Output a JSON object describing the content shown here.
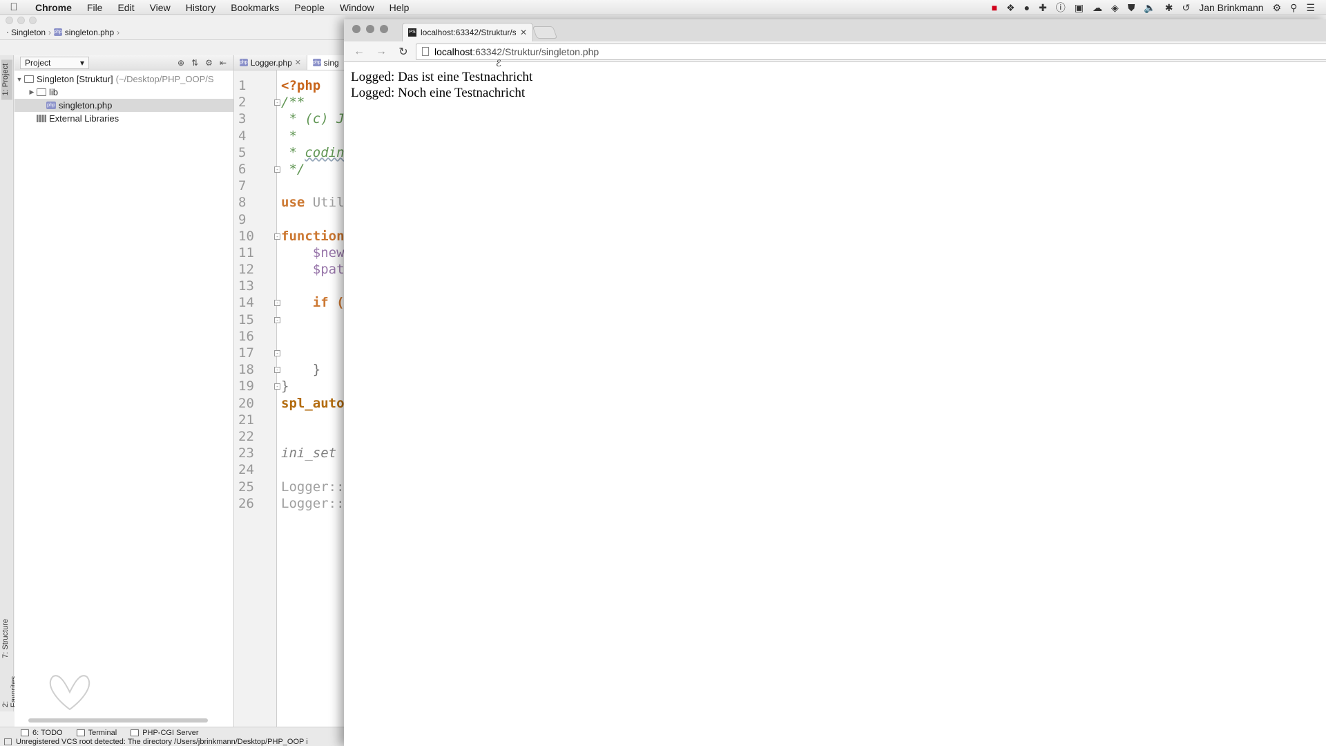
{
  "menubar": {
    "app_name": "Chrome",
    "items": [
      "File",
      "Edit",
      "View",
      "History",
      "Bookmarks",
      "People",
      "Window",
      "Help"
    ],
    "user_name": "Jan Brinkmann"
  },
  "ide": {
    "breadcrumb": {
      "project": "Singleton",
      "file": "singleton.php"
    },
    "sidebar_tabs": {
      "project": "1: Project",
      "structure": "7: Structure",
      "favorites": "2: Favorites"
    },
    "project_dropdown": "Project",
    "tree": {
      "root_name": "Singleton [Struktur]",
      "root_path": "(~/Desktop/PHP_OOP/S",
      "lib": "lib",
      "file": "singleton.php",
      "external": "External Libraries"
    },
    "editor_tabs": [
      "Logger.php",
      "sing"
    ],
    "line_numbers": [
      "1",
      "2",
      "3",
      "4",
      "5",
      "6",
      "7",
      "8",
      "9",
      "10",
      "11",
      "12",
      "13",
      "14",
      "15",
      "16",
      "17",
      "18",
      "19",
      "20",
      "21",
      "22",
      "23",
      "24",
      "25",
      "26"
    ],
    "code": {
      "l1": "<?php",
      "l2": "/**",
      "l3": " * (c) J",
      "l4": " *",
      "l5_star": " * ",
      "l5_word": "codin",
      "l6": " */",
      "l8_kw": "use ",
      "l8_rest": "Util",
      "l10": "function",
      "l11": "    $new",
      "l12": "    $pat",
      "l14": "    if (",
      "l18": "    }",
      "l19": "}",
      "l20": "spl_auto",
      "l23": "ini_set",
      "l25": "Logger::",
      "l26": "Logger::"
    },
    "bottom_tools": [
      "6: TODO",
      "Terminal",
      "PHP-CGI Server"
    ],
    "status_text": "Unregistered VCS root detected: The directory /Users/jbrinkmann/Desktop/PHP_OOP i"
  },
  "chrome": {
    "tab_title": "localhost:63342/Struktur/s",
    "url_host": "localhost",
    "url_rest": ":63342/Struktur/singleton.php",
    "output": [
      "Logged: Das ist eine Testnachricht",
      "Logged: Noch eine Testnachricht"
    ]
  }
}
